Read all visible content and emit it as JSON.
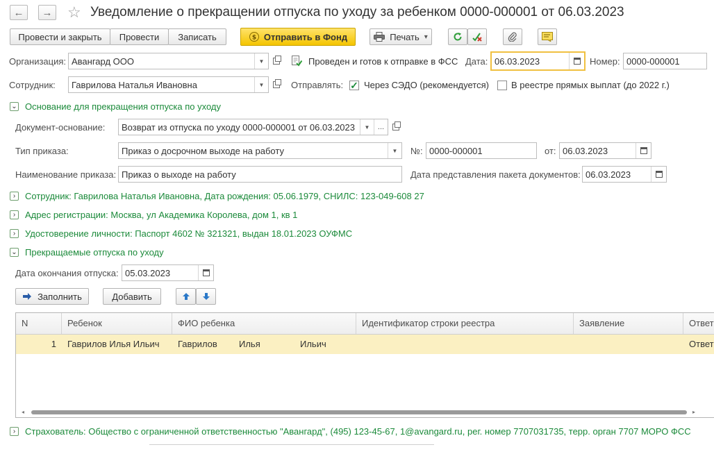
{
  "header": {
    "back_glyph": "←",
    "forward_glyph": "→",
    "star_glyph": "☆",
    "title": "Уведомление о прекращении отпуска по уходу за ребенком 0000-000001 от 06.03.2023"
  },
  "toolbar": {
    "post_close": "Провести и закрыть",
    "post": "Провести",
    "save": "Записать",
    "send_fund": "Отправить в Фонд",
    "print": "Печать",
    "print_arrow": "▾"
  },
  "form": {
    "org_label": "Организация:",
    "org_value": "Авангард ООО",
    "status_text": "Проведен и готов к отправке в ФСС",
    "date_label": "Дата:",
    "date_value": "06.03.2023",
    "number_label": "Номер:",
    "number_value": "0000-000001",
    "employee_label": "Сотрудник:",
    "employee_value": "Гаврилова Наталья Ивановна",
    "send_label": "Отправлять:",
    "sedo_label": "Через СЭДО (рекомендуется)",
    "registry_label": "В реестре прямых выплат (до 2022 г.)"
  },
  "basis": {
    "header": "Основание для прекращения отпуска по уходу",
    "doc_label": "Документ-основание:",
    "doc_value": "Возврат из отпуска по уходу 0000-000001 от 06.03.2023",
    "dots": "...",
    "order_type_label": "Тип приказа:",
    "order_type_value": "Приказ о досрочном выходе на работу",
    "order_no_label": "№:",
    "order_no_value": "0000-000001",
    "order_from_label": "от:",
    "order_from_value": "06.03.2023",
    "order_name_label": "Наименование приказа:",
    "order_name_value": "Приказ о выходе на работу",
    "package_date_label": "Дата представления пакета документов:",
    "package_date_value": "06.03.2023"
  },
  "groups": {
    "employee": "Сотрудник: Гаврилова Наталья Ивановна, Дата рождения: 05.06.1979, СНИЛС: 123-049-608 27",
    "address": "Адрес регистрации: Москва, ул Академика Королева, дом 1, кв 1",
    "identity": "Удостоверение личности: Паспорт 4602 № 321321, выдан 18.01.2023 ОУФМС",
    "leaves": "Прекращаемые отпуска по уходу",
    "insurer": "Страхователь: Общество с ограниченной ответственностью \"Авангард\", (495) 123-45-67, 1@avangard.ru, рег. номер 7707031735, терр. орган 7707 МОРО ФСС"
  },
  "leaves": {
    "end_date_label": "Дата окончания отпуска:",
    "end_date_value": "05.03.2023",
    "fill_button": "Заполнить",
    "add_button": "Добавить"
  },
  "table": {
    "headers": [
      "N",
      "Ребенок",
      "ФИО ребенка",
      "Идентификатор строки реестра",
      "Заявление",
      "Ответ"
    ],
    "row": {
      "n": "1",
      "child": "Гаврилов Илья Ильич",
      "last": "Гаврилов",
      "first": "Илья",
      "middle": "Ильич",
      "registry_id": "",
      "statement": "",
      "answer": "Ответ"
    }
  },
  "colors": {
    "accent_green": "#1b8a3a",
    "row_highlight": "#fbf0c2",
    "send_button": "#f4c400",
    "date_focus": "#f0c040"
  }
}
